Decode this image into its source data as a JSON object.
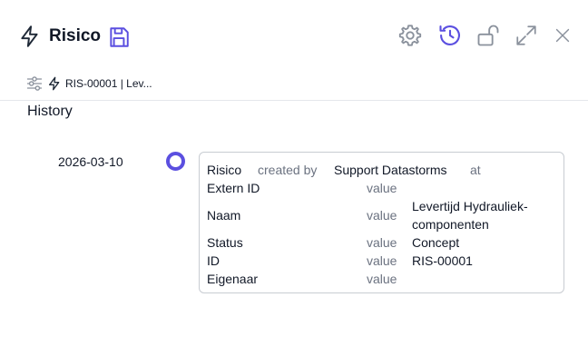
{
  "header": {
    "title": "Risico"
  },
  "breadcrumb": {
    "text": "RIS-00001 | Lev..."
  },
  "section": {
    "title": "History"
  },
  "timeline": [
    {
      "date": "2026-03-10",
      "entry": {
        "entity": "Risico",
        "created_by_label": "created by",
        "author": "Support Datastorms",
        "at_label": "at",
        "fields": [
          {
            "name": "Extern ID",
            "label": "value",
            "value": ""
          },
          {
            "name": "Naam",
            "label": "value",
            "value": "Levertijd Hydrauliek-\ncomponenten"
          },
          {
            "name": "Status",
            "label": "value",
            "value": "Concept"
          },
          {
            "name": "ID",
            "label": "value",
            "value": "RIS-00001"
          },
          {
            "name": "Eigenaar",
            "label": "value",
            "value": ""
          }
        ]
      }
    }
  ],
  "colors": {
    "accent": "#5b4fe0",
    "icon": "#8a919c",
    "text": "#111827",
    "muted": "#6b7280"
  },
  "icons": [
    "bolt-icon",
    "save-icon",
    "gear-icon",
    "history-icon",
    "unlock-icon",
    "expand-icon",
    "close-icon",
    "filter-icon"
  ]
}
